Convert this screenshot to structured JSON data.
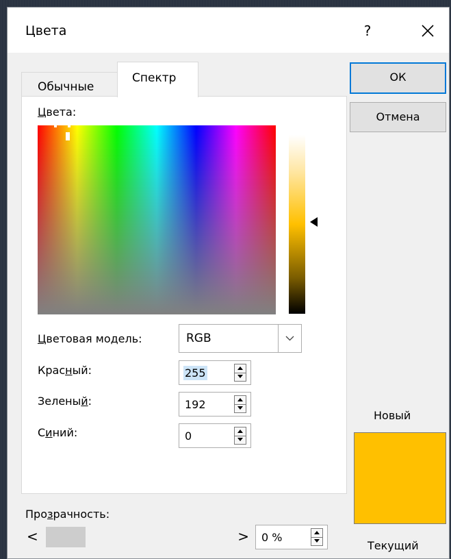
{
  "window": {
    "title": "Цвета",
    "help": "?"
  },
  "tabs": [
    {
      "label": "Обычные"
    },
    {
      "label": "Спектр"
    }
  ],
  "spectrum": {
    "label_prefix": "Ц",
    "label_rest": "вета:"
  },
  "color_model": {
    "label_prefix": "Ц",
    "label_rest": "ветовая модель:",
    "value": "RGB"
  },
  "red": {
    "label_a": "Крас",
    "label_u": "н",
    "label_b": "ый:",
    "value": "255"
  },
  "green": {
    "label_a": "Зелены",
    "label_u": "й",
    "label_b": ":",
    "value": "192"
  },
  "blue": {
    "label_a": "С",
    "label_u": "и",
    "label_b": "ний:",
    "value": "0"
  },
  "transparency": {
    "label_a": "Про",
    "label_u": "з",
    "label_b": "рачность:",
    "value": "0 %",
    "scroll_left": "<",
    "scroll_right": ">"
  },
  "buttons": {
    "ok": "ОК",
    "cancel": "Отмена"
  },
  "preview": {
    "new_label": "Новый",
    "current_label": "Текущий",
    "color": "#ffc000"
  },
  "colors": {
    "accent": "#0078d7",
    "selection": "#cce4f7"
  }
}
